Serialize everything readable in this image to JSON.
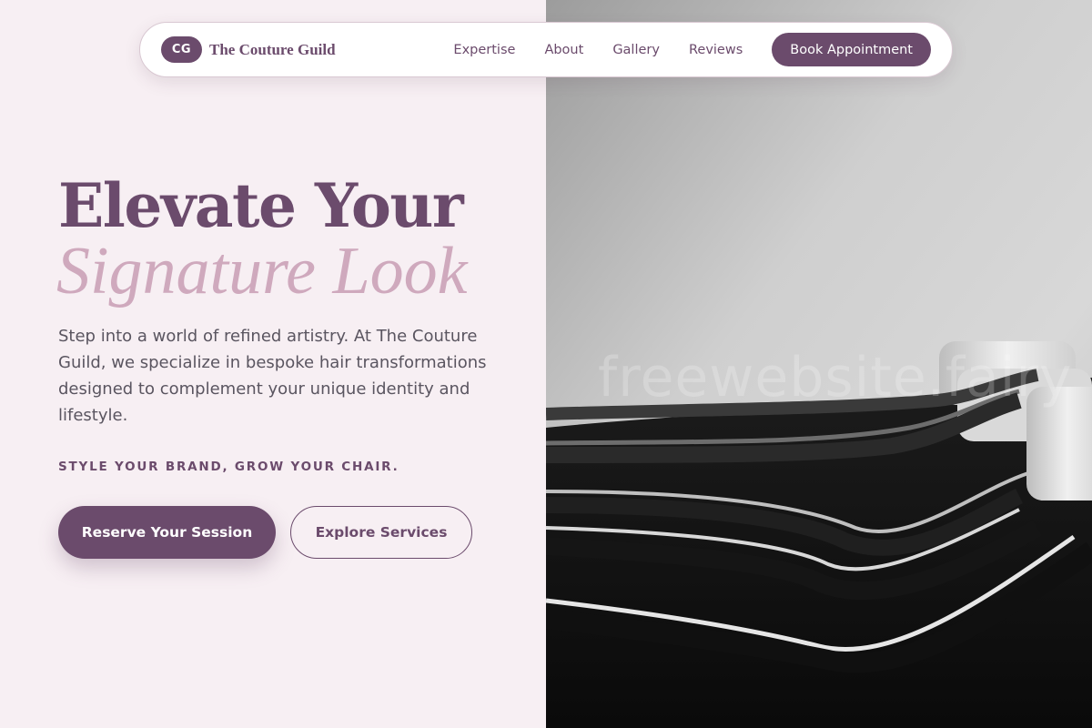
{
  "nav": {
    "badge": "CG",
    "brand": "The Couture Guild",
    "links": [
      "Expertise",
      "About",
      "Gallery",
      "Reviews"
    ],
    "cta": "Book Appointment"
  },
  "hero": {
    "headline": "Elevate Your",
    "headline_accent": "Signature Look",
    "intro": "Step into a world of refined artistry. At The Couture Guild, we specialize in bespoke hair transformations designed to complement your unique identity and lifestyle.",
    "tagline": "STYLE YOUR BRAND, GROW YOUR CHAIR.",
    "primary_button": "Reserve Your Session",
    "secondary_button": "Explore Services"
  },
  "image": {
    "watermark": "freewebsite.fairy"
  },
  "colors": {
    "brand": "#6b4b6c",
    "accent": "#cfa9bd",
    "background": "#f7eff3"
  }
}
